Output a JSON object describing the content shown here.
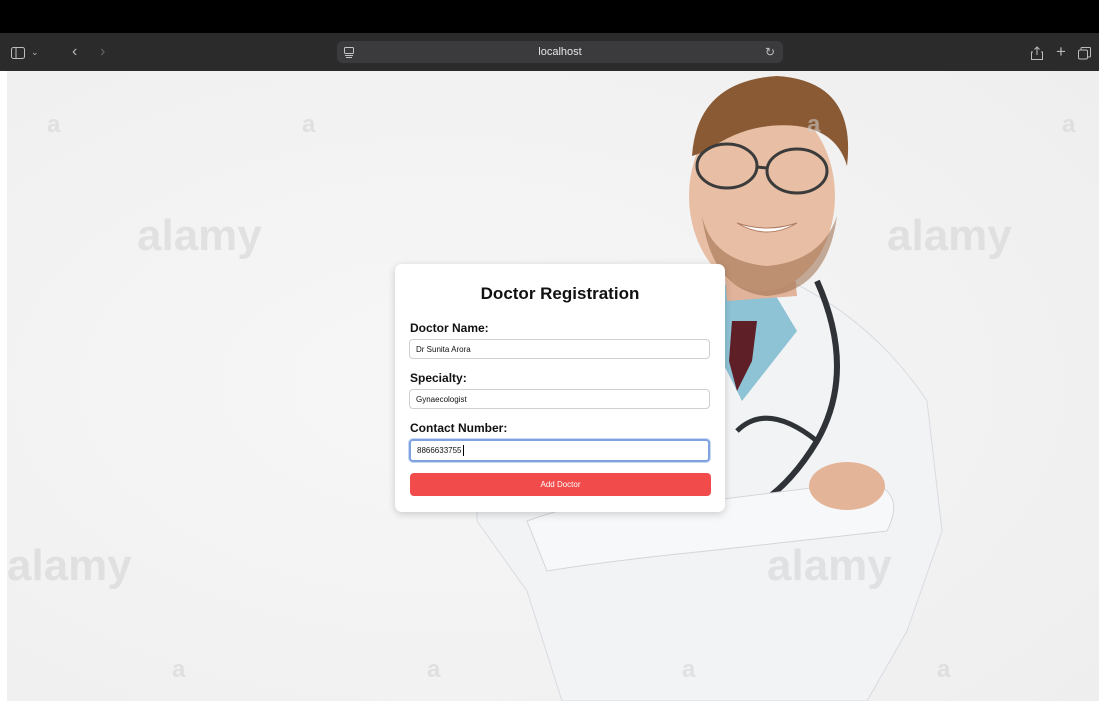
{
  "browser": {
    "url": "localhost",
    "icons": [
      "sidebar-icon",
      "chevron-down-icon",
      "back-icon",
      "forward-icon",
      "page-settings-icon",
      "reload-icon",
      "share-icon",
      "new-tab-icon",
      "tabs-overview-icon"
    ]
  },
  "watermarks": [
    "alamy",
    "alamy",
    "alamy",
    "alamy",
    "a",
    "a",
    "a",
    "a",
    "a",
    "a",
    "a",
    "a"
  ],
  "form": {
    "title": "Doctor Registration",
    "name_label": "Doctor Name:",
    "name_value": "Dr Sunita Arora",
    "specialty_label": "Specialty:",
    "specialty_value": "Gynaecologist",
    "contact_label": "Contact Number:",
    "contact_value": "8866633755",
    "submit_label": "Add Doctor"
  },
  "colors": {
    "button": "#f24b4b",
    "focus": "#7ea3e0",
    "toolbar": "#2b2b2b"
  }
}
